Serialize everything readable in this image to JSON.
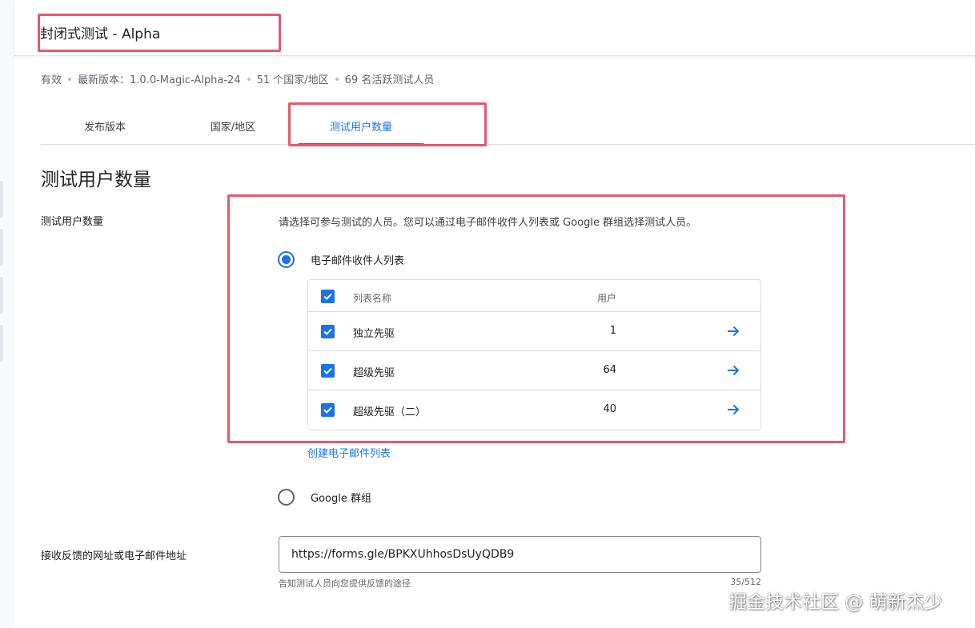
{
  "header": {
    "title": "封闭式测试 - Alpha"
  },
  "status": {
    "state": "有效",
    "version": "最新版本：1.0.0-Magic-Alpha-24",
    "countries": "51 个国家/地区",
    "testers": "69 名活跃测试人员"
  },
  "tabs": [
    {
      "label": "发布版本"
    },
    {
      "label": "国家/地区"
    },
    {
      "label": "测试用户数量"
    }
  ],
  "section": {
    "heading": "测试用户数量",
    "row_label": "测试用户数量",
    "description": "请选择可参与测试的人员。您可以通过电子邮件收件人列表或 Google 群组选择测试人员。"
  },
  "options": {
    "email": "电子邮件收件人列表",
    "google": "Google 群组"
  },
  "table": {
    "headers": {
      "name": "列表名称",
      "users": "用户"
    },
    "rows": [
      {
        "name": "独立先驱",
        "users": "1"
      },
      {
        "name": "超级先驱",
        "users": "64"
      },
      {
        "name": "超级先驱（二）",
        "users": "40"
      }
    ]
  },
  "create_link": "创建电子邮件列表",
  "feedback": {
    "label": "接收反馈的网址或电子邮件地址",
    "value": "https://forms.gle/BPKXUhhosDsUyQDB9",
    "helper": "告知测试人员向您提供反馈的途径",
    "counter": "35/512"
  },
  "watermark": "掘金技术社区 @ 萌新杰少",
  "colors": {
    "accent": "#1a73e8",
    "highlight": "#e9566c"
  }
}
